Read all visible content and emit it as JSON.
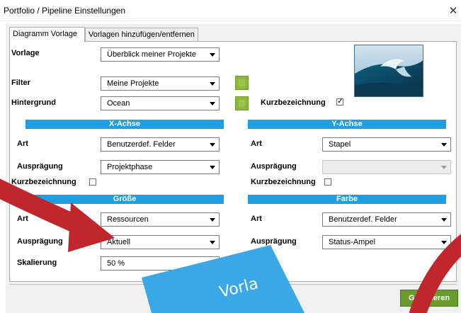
{
  "window": {
    "title": "Portfolio / Pipeline Einstellungen",
    "close_glyph": "✕"
  },
  "tabs": [
    {
      "label": "Diagramm Vorlage",
      "active": true
    },
    {
      "label": "Vorlagen hinzufügen/entfernen",
      "active": false
    }
  ],
  "top": {
    "vorlage_label": "Vorlage",
    "vorlage_value": "Überblick meiner Projekte",
    "filter_label": "Filter",
    "filter_value": "Meine Projekte",
    "hintergrund_label": "Hintergrund",
    "hintergrund_value": "Ocean",
    "kurz_label": "Kurzbezeichnung",
    "kurz_checked": true
  },
  "xachse": {
    "header": "X-Achse",
    "art_label": "Art",
    "art_value": "Benutzerdef. Felder",
    "auspraegung_label": "Ausprägung",
    "auspraegung_value": "Projektphase",
    "kurz_label": "Kurzbezeichnung",
    "kurz_checked": false
  },
  "yachse": {
    "header": "Y-Achse",
    "art_label": "Art",
    "art_value": "Stapel",
    "auspraegung_label": "Ausprägung",
    "auspraegung_value": "",
    "kurz_label": "Kurzbezeichnung",
    "kurz_checked": false
  },
  "groesse": {
    "header": "Größe",
    "art_label": "Art",
    "art_value": "Ressourcen",
    "auspraegung_label": "Ausprägung",
    "auspraegung_value": "Aktuell",
    "skalierung_label": "Skalierung",
    "skalierung_value": "50 %"
  },
  "farbe": {
    "header": "Farbe",
    "art_label": "Art",
    "art_value": "Benutzerdef. Felder",
    "auspraegung_label": "Ausprägung",
    "auspraegung_value": "Status-Ampel"
  },
  "buttons": {
    "generate_label": "Generieren"
  },
  "overlay": {
    "note_text": "Vorla"
  },
  "colors": {
    "header_band": "#1e9fe2",
    "arrow_red": "#c0272d",
    "callout_blue": "#3aa8e6",
    "generate_green": "#6a9b2d"
  }
}
